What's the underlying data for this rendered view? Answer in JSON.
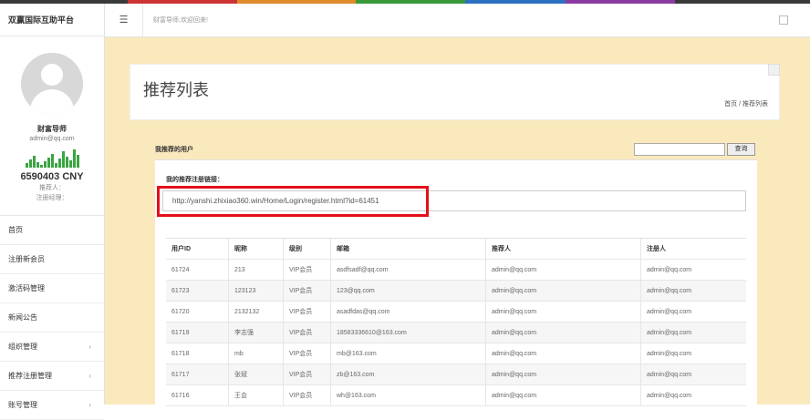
{
  "brand": "双赢国际互助平台",
  "header": {
    "welcome": "财富导师,欢迎回来!",
    "menu_icon": "hamburger-icon",
    "expand_icon": "window-icon"
  },
  "profile": {
    "name": "财富导师",
    "email": "admin@qq.com",
    "balance": "6590403 CNY",
    "referrer": "推荐人：",
    "manager": "注册经理："
  },
  "menu": [
    {
      "label": "首页",
      "has_children": false
    },
    {
      "label": "注册新会员",
      "has_children": false
    },
    {
      "label": "激活码管理",
      "has_children": false
    },
    {
      "label": "新闻公告",
      "has_children": false
    },
    {
      "label": "组织管理",
      "has_children": true
    },
    {
      "label": "推荐注册管理",
      "has_children": true
    },
    {
      "label": "账号管理",
      "has_children": true
    }
  ],
  "page": {
    "title": "推荐列表",
    "breadcrumb": "首页 / 推荐列表"
  },
  "panel": {
    "heading": "我推荐的用户",
    "search_button": "查询",
    "search_value": "",
    "link_label": "我的推荐注册链接：",
    "link_value": "http://yanshi.zhixiao360.win/Home/Login/register.html?id=61451"
  },
  "table": {
    "columns": [
      "用户ID",
      "昵称",
      "级别",
      "邮箱",
      "推荐人",
      "注册人"
    ],
    "rows": [
      [
        "61724",
        "213",
        "VIP会员",
        "asdfsadf@qq.com",
        "admin@qq.com",
        "admin@qq.com"
      ],
      [
        "61723",
        "123123",
        "VIP会员",
        "123@qq.com",
        "admin@qq.com",
        "admin@qq.com"
      ],
      [
        "61720",
        "2132132",
        "VIP会员",
        "asadfdas@qq.com",
        "admin@qq.com",
        "admin@qq.com"
      ],
      [
        "61719",
        "李志强",
        "VIP会员",
        "18583336610@163.com",
        "admin@qq.com",
        "admin@qq.com"
      ],
      [
        "61718",
        "mb",
        "VIP会员",
        "mb@163.com",
        "admin@qq.com",
        "admin@qq.com"
      ],
      [
        "61717",
        "张斌",
        "VIP会员",
        "zb@163.com",
        "admin@qq.com",
        "admin@qq.com"
      ],
      [
        "61716",
        "王会",
        "VIP会员",
        "wh@163.com",
        "admin@qq.com",
        "admin@qq.com"
      ]
    ]
  },
  "colors": {
    "main_bg": "#fbe9be",
    "highlight": "#e3101a",
    "signal": "#3aa542"
  }
}
